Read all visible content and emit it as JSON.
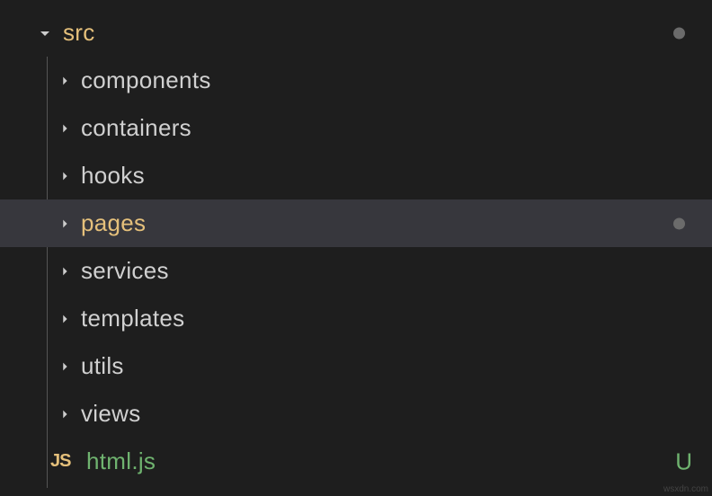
{
  "root": {
    "name": "src",
    "expanded": true,
    "modified": true
  },
  "children": [
    {
      "name": "components",
      "expanded": false,
      "selected": false
    },
    {
      "name": "containers",
      "expanded": false,
      "selected": false
    },
    {
      "name": "hooks",
      "expanded": false,
      "selected": false
    },
    {
      "name": "pages",
      "expanded": false,
      "selected": true,
      "modified": true
    },
    {
      "name": "services",
      "expanded": false,
      "selected": false
    },
    {
      "name": "templates",
      "expanded": false,
      "selected": false
    },
    {
      "name": "utils",
      "expanded": false,
      "selected": false
    },
    {
      "name": "views",
      "expanded": false,
      "selected": false
    }
  ],
  "file": {
    "name": "html.js",
    "icon": "JS",
    "gitStatus": "U"
  },
  "watermark": "wsxdn.com"
}
